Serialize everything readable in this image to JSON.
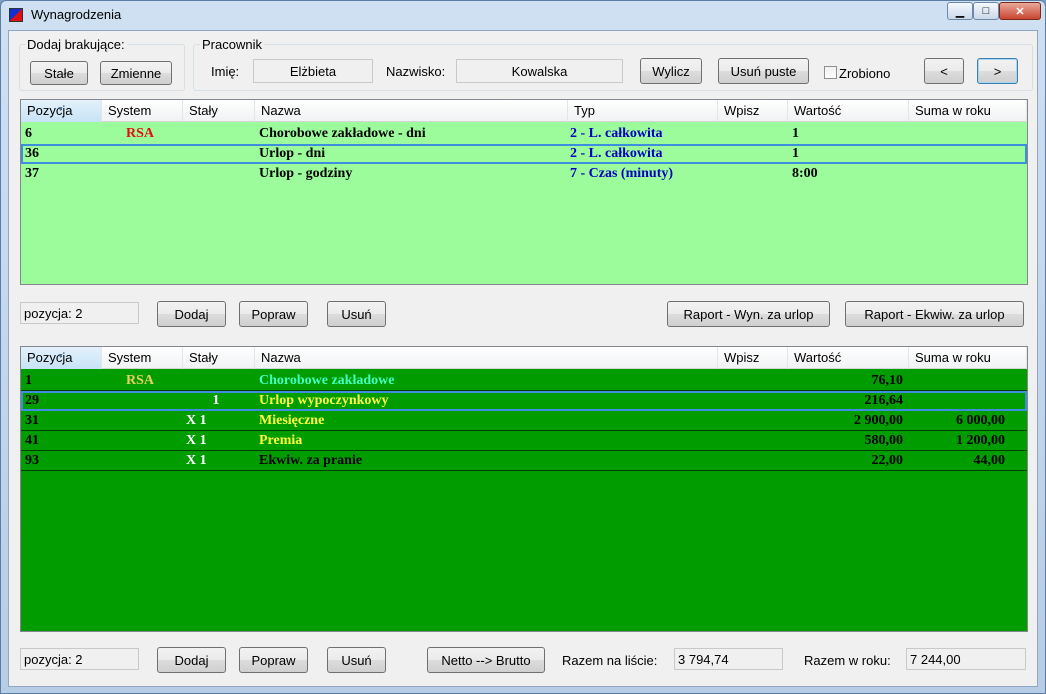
{
  "window": {
    "title": "Wynagrodzenia",
    "min_glyph": "▁",
    "max_glyph": "□",
    "close_glyph": "✕"
  },
  "add_missing": {
    "label": "Dodaj brakujące:",
    "fixed_button": "Stałe",
    "variable_button": "Zmienne"
  },
  "employee": {
    "group_label": "Pracownik",
    "first_name_label": "Imię:",
    "first_name": "Elżbieta",
    "last_name_label": "Nazwisko:",
    "last_name": "Kowalska",
    "calculate_button": "Wylicz",
    "delete_empty_button": "Usuń puste",
    "done_label": "Zrobiono",
    "done_checked": false,
    "prev_button": "<",
    "next_button": ">"
  },
  "top_grid": {
    "columns": [
      "Pozycja",
      "System",
      "Stały",
      "Nazwa",
      "Typ",
      "Wpisz",
      "Wartość",
      "Suma w roku"
    ],
    "background": "#9cfc9c",
    "rows": [
      {
        "pozycja": "6",
        "system": "RSA",
        "staly": "",
        "nazwa": "Chorobowe zakładowe - dni",
        "typ": "2 - L. całkowita",
        "wpisz": "",
        "wartosc": "1",
        "suma": ""
      },
      {
        "pozycja": "36",
        "system": "",
        "staly": "",
        "nazwa": "Urlop - dni",
        "typ": "2 - L. całkowita",
        "wpisz": "",
        "wartosc": "1",
        "suma": ""
      },
      {
        "pozycja": "37",
        "system": "",
        "staly": "",
        "nazwa": "Urlop - godziny",
        "typ": "7 - Czas (minuty)",
        "wpisz": "",
        "wartosc": "8:00",
        "suma": ""
      }
    ]
  },
  "top_toolbar": {
    "position_text": "pozycja:  2",
    "add_button": "Dodaj",
    "edit_button": "Popraw",
    "delete_button": "Usuń",
    "report_vacation_pay_button": "Raport - Wyn. za urlop",
    "report_vacation_equiv_button": "Raport - Ekwiw. za urlop"
  },
  "bottom_grid": {
    "columns": [
      "Pozycja",
      "System",
      "Stały",
      "Nazwa",
      "Wpisz",
      "Wartość",
      "Suma w roku"
    ],
    "background": "#009c00",
    "rows": [
      {
        "pozycja": "1",
        "system": "RSA",
        "staly": "",
        "nazwa": "Chorobowe zakładowe",
        "wpisz": "",
        "wartosc": "76,10",
        "suma": "",
        "name_color": "#40ffc0"
      },
      {
        "pozycja": "29",
        "system": "",
        "staly": "1",
        "nazwa": "Urlop wypoczynkowy",
        "wpisz": "",
        "wartosc": "216,64",
        "suma": "",
        "name_color": "#ffff40"
      },
      {
        "pozycja": "31",
        "system": "",
        "staly": "X 1",
        "nazwa": "Miesięczne",
        "wpisz": "",
        "wartosc": "2 900,00",
        "suma": "6 000,00",
        "name_color": "#ffff40"
      },
      {
        "pozycja": "41",
        "system": "",
        "staly": "X 1",
        "nazwa": "Premia",
        "wpisz": "",
        "wartosc": "580,00",
        "suma": "1 200,00",
        "name_color": "#ffff40"
      },
      {
        "pozycja": "93",
        "system": "",
        "staly": "X 1",
        "nazwa": "Ekwiw. za pranie",
        "wpisz": "",
        "wartosc": "22,00",
        "suma": "44,00",
        "name_color": "#000000"
      }
    ]
  },
  "bottom_toolbar": {
    "position_text": "pozycja:  2",
    "add_button": "Dodaj",
    "edit_button": "Popraw",
    "delete_button": "Usuń",
    "net_gross_button": "Netto --> Brutto",
    "list_total_label": "Razem na liście:",
    "list_total": "3 794,74",
    "year_total_label": "Razem w roku:",
    "year_total": "7 244,00"
  }
}
